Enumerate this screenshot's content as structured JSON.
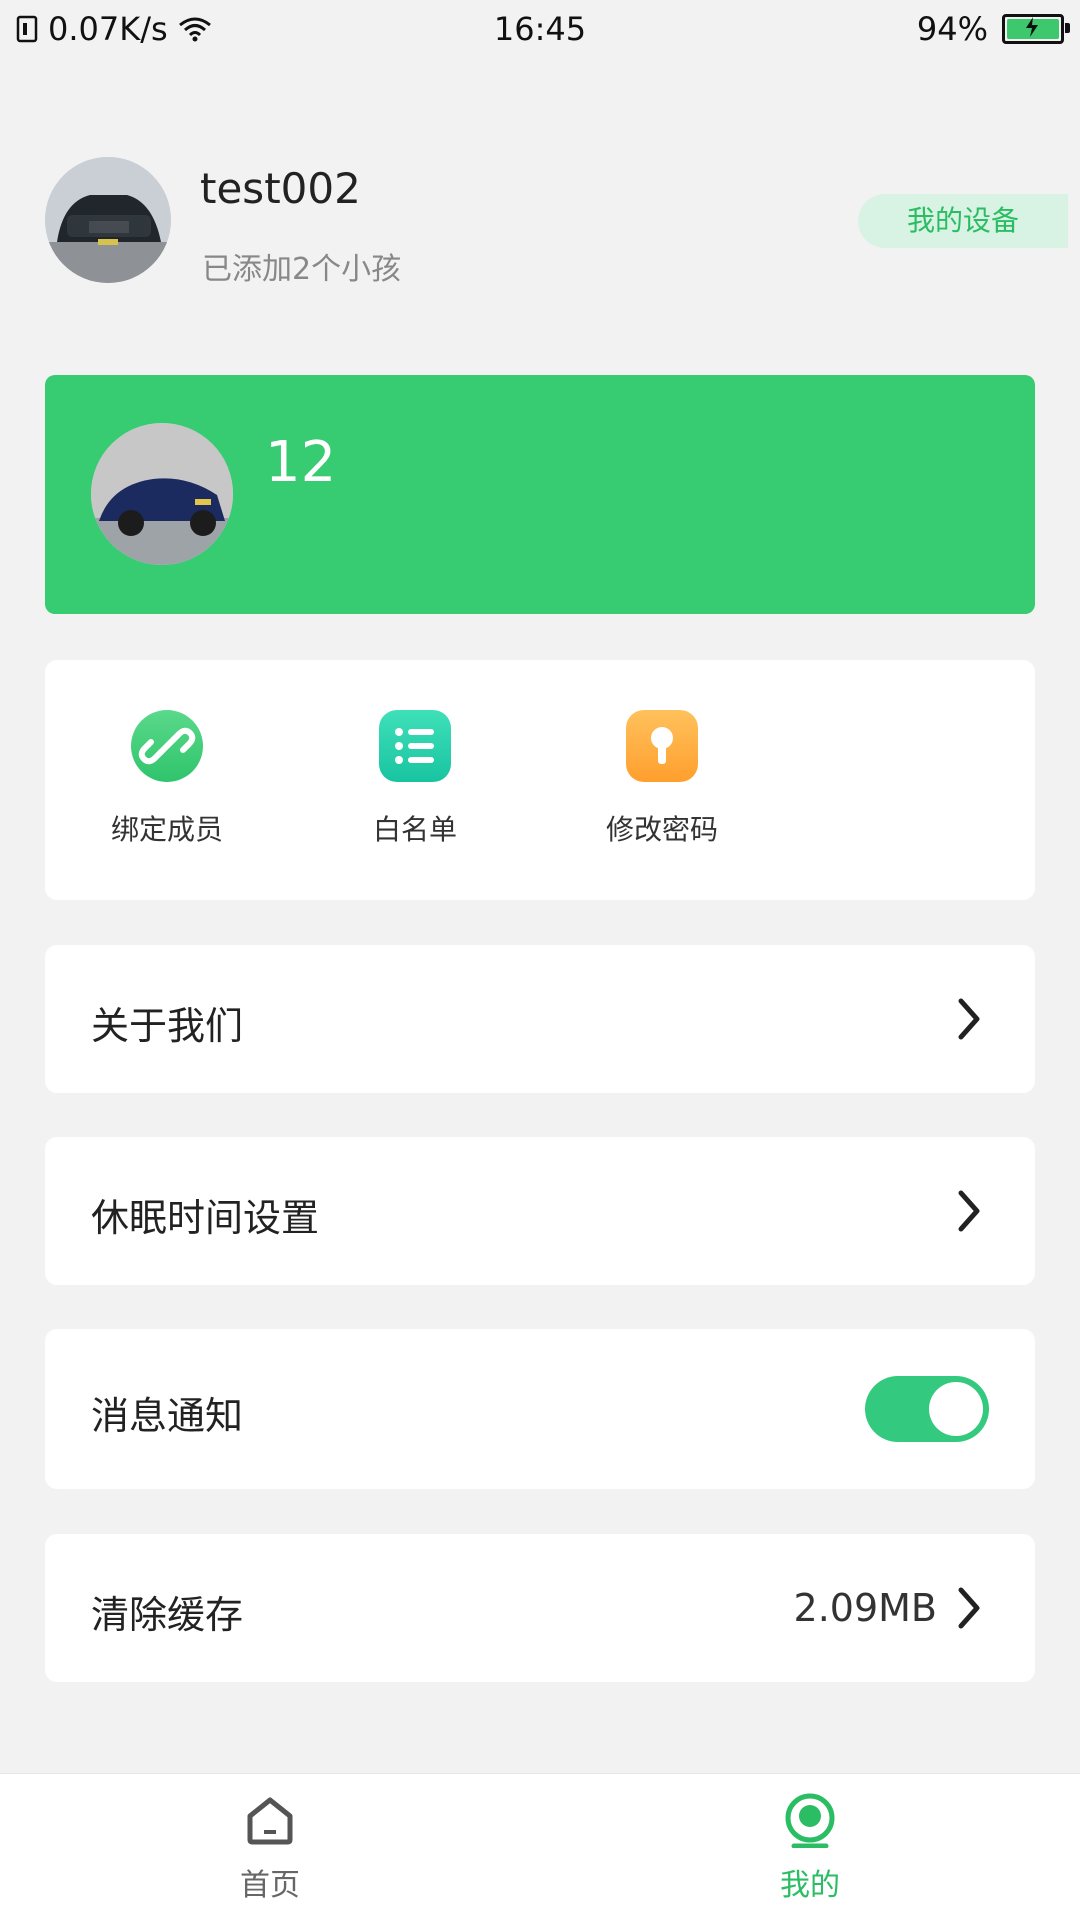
{
  "status_bar": {
    "network_speed": "0.07K/s",
    "time": "16:45",
    "battery_percent": "94%"
  },
  "profile": {
    "username": "test002",
    "children_added": "已添加2个小孩",
    "device_button": "我的设备"
  },
  "child_card": {
    "name": "12"
  },
  "actions": [
    {
      "label": "绑定成员",
      "icon": "link-icon"
    },
    {
      "label": "白名单",
      "icon": "list-icon"
    },
    {
      "label": "修改密码",
      "icon": "key-icon"
    }
  ],
  "menu": {
    "about": "关于我们",
    "sleep_settings": "休眠时间设置",
    "notifications": "消息通知",
    "notifications_enabled": true,
    "clear_cache": "清除缓存",
    "cache_size": "2.09MB"
  },
  "bottom_nav": {
    "home": "首页",
    "mine": "我的",
    "active": "mine"
  },
  "colors": {
    "accent_green": "#37cc71",
    "toggle_green": "#33c97e",
    "pill_bg": "#d8f3e3"
  }
}
